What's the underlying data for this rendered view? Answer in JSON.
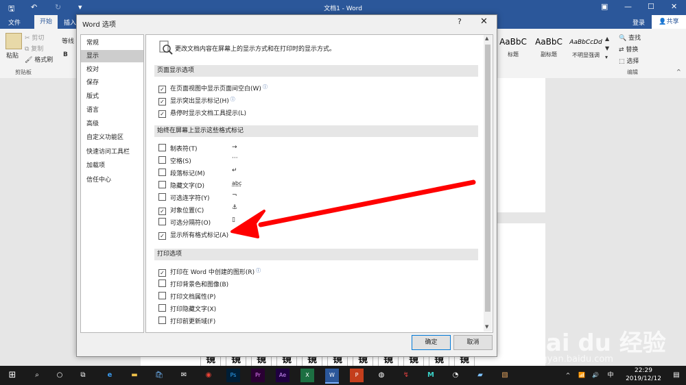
{
  "window": {
    "doc_title": "文档1 - Word",
    "tabs": [
      "文件",
      "开始",
      "插入"
    ],
    "active_tab": "开始",
    "login": "登录",
    "share": "共享",
    "quick_access": {
      "save": "🖫",
      "undo": "↶",
      "redo": "↻",
      "more": "▾"
    },
    "controls": {
      "ribbon_opts": "▣",
      "min": "—",
      "max": "☐",
      "close": "✕"
    }
  },
  "ribbon": {
    "paste": "粘贴",
    "cut": "剪切",
    "copy": "复制",
    "format_painter": "格式刷",
    "clipboard_group": "剪贴板",
    "font_name": "等线",
    "bold": "B",
    "styles": [
      {
        "preview": "AaBbC",
        "name": "标题"
      },
      {
        "preview": "AaBbC",
        "name": "副标题"
      },
      {
        "preview": "AaBbCcDd",
        "name": "不明显强调"
      }
    ],
    "find": "查找",
    "replace": "替换",
    "select": "选择",
    "editing_group": "编辑"
  },
  "document": {
    "visible_chars": [
      "镜",
      "镜",
      "镜",
      "镜",
      "镜",
      "镜",
      "镜",
      "镜",
      "镜",
      "镜",
      "镜"
    ]
  },
  "dialog": {
    "title": "Word 选项",
    "help": "?",
    "close": "✕",
    "nav": [
      "常规",
      "显示",
      "校对",
      "保存",
      "版式",
      "语言",
      "高级",
      "自定义功能区",
      "快速访问工具栏",
      "加载项",
      "信任中心"
    ],
    "selected_nav": "显示",
    "intro": "更改文档内容在屏幕上的显示方式和在打印时的显示方式。",
    "sections": [
      {
        "title": "页面显示选项",
        "options": [
          {
            "label": "在页面视图中显示页面间空白(W)",
            "checked": true,
            "info": true
          },
          {
            "label": "显示突出显示标记(H)",
            "checked": true,
            "info": true
          },
          {
            "label": "悬停时显示文档工具提示(L)",
            "checked": true,
            "info": false
          }
        ]
      },
      {
        "title": "始终在屏幕上显示这些格式标记",
        "options": [
          {
            "label": "制表符(T)",
            "checked": false,
            "symbol": "→"
          },
          {
            "label": "空格(S)",
            "checked": false,
            "symbol": "···"
          },
          {
            "label": "段落标记(M)",
            "checked": false,
            "symbol": "↵"
          },
          {
            "label": "隐藏文字(D)",
            "checked": false,
            "symbol": "abc"
          },
          {
            "label": "可选连字符(Y)",
            "checked": false,
            "symbol": "¬"
          },
          {
            "label": "对象位置(C)",
            "checked": true,
            "symbol": "⚓"
          },
          {
            "label": "可选分隔符(O)",
            "checked": false,
            "symbol": "▯"
          },
          {
            "label": "显示所有格式标记(A)",
            "checked": true
          }
        ]
      },
      {
        "title": "打印选项",
        "options": [
          {
            "label": "打印在 Word 中创建的图形(R)",
            "checked": true,
            "info": true
          },
          {
            "label": "打印背景色和图像(B)",
            "checked": false
          },
          {
            "label": "打印文档属性(P)",
            "checked": false
          },
          {
            "label": "打印隐藏文字(X)",
            "checked": false
          },
          {
            "label": "打印前更新域(F)",
            "checked": false
          }
        ]
      }
    ],
    "ok": "确定",
    "cancel": "取消"
  },
  "taskbar": {
    "time": "22:29",
    "date": "2019/12/12",
    "ime": "中",
    "system_icons": [
      "^",
      "📶",
      "🔊",
      "中"
    ]
  },
  "watermark": {
    "brand": "Bai du 经验",
    "url": "jingyan.baidu.com"
  },
  "colors": {
    "word_blue": "#2b579a",
    "annotation_arrow": "#ff0000"
  }
}
